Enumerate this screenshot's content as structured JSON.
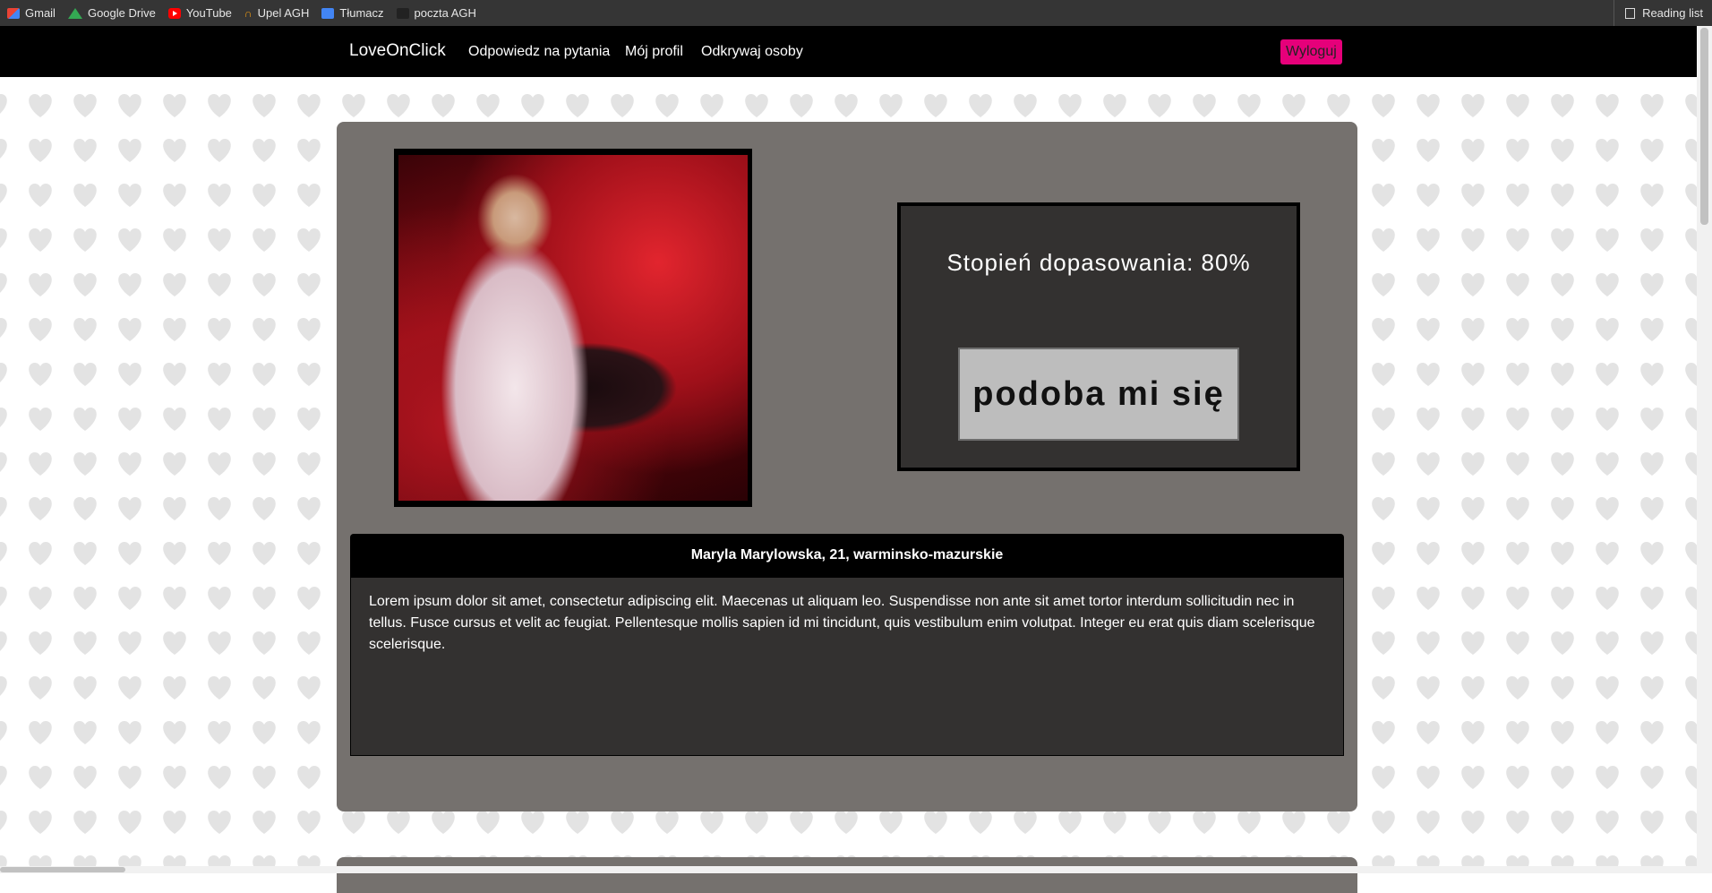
{
  "bookmarks": [
    {
      "label": "Gmail",
      "icon": "gmail-icon"
    },
    {
      "label": "Google Drive",
      "icon": "google-drive-icon"
    },
    {
      "label": "YouTube",
      "icon": "youtube-icon"
    },
    {
      "label": "Upel AGH",
      "icon": "upel-icon"
    },
    {
      "label": "Tłumacz",
      "icon": "translate-icon"
    },
    {
      "label": "poczta AGH",
      "icon": "mail-icon"
    }
  ],
  "reading_list": "Reading list",
  "navbar": {
    "brand": "LoveOnClick",
    "links": [
      "Odpowiedz na pytania",
      "Mój profil",
      "Odkrywaj osoby"
    ],
    "logout": "Wyloguj"
  },
  "profile": {
    "match_text": "Stopień dopasowania: 80%",
    "like_button": "podoba mi się",
    "header": "Maryla Marylowska, 21, warminsko-mazurskie",
    "description": "Lorem ipsum dolor sit amet, consectetur adipiscing elit. Maecenas ut aliquam leo. Suspendisse non ante sit amet tortor interdum sollicitudin nec in tellus. Fusce cursus et velit ac feugiat. Pellentesque mollis sapien id mi tincidunt, quis vestibulum enim volutpat. Integer eu erat quis diam scelerisque scelerisque."
  },
  "colors": {
    "accent": "#e6007a",
    "card": "#75716e",
    "panel": "#333130"
  }
}
